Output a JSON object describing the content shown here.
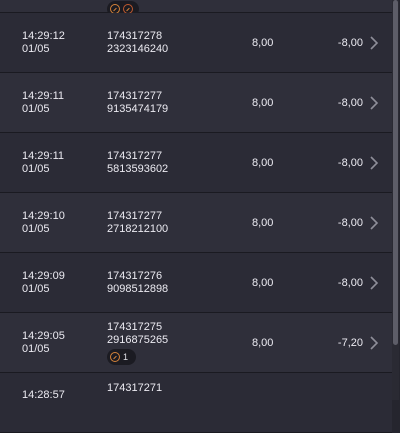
{
  "rows": [
    {
      "time": "",
      "date": "",
      "ticket_a": "",
      "ticket_b": "",
      "amount": "",
      "net": "",
      "badge": ""
    },
    {
      "time": "14:29:12",
      "date": "01/05",
      "ticket_a": "174317278",
      "ticket_b": "2323146240",
      "amount": "8,00",
      "net": "-8,00",
      "badge": ""
    },
    {
      "time": "14:29:11",
      "date": "01/05",
      "ticket_a": "174317277",
      "ticket_b": "9135474179",
      "amount": "8,00",
      "net": "-8,00",
      "badge": ""
    },
    {
      "time": "14:29:11",
      "date": "01/05",
      "ticket_a": "174317277",
      "ticket_b": "5813593602",
      "amount": "8,00",
      "net": "-8,00",
      "badge": ""
    },
    {
      "time": "14:29:10",
      "date": "01/05",
      "ticket_a": "174317277",
      "ticket_b": "2718212100",
      "amount": "8,00",
      "net": "-8,00",
      "badge": ""
    },
    {
      "time": "14:29:09",
      "date": "01/05",
      "ticket_a": "174317276",
      "ticket_b": "9098512898",
      "amount": "8,00",
      "net": "-8,00",
      "badge": ""
    },
    {
      "time": "14:29:05",
      "date": "01/05",
      "ticket_a": "174317275",
      "ticket_b": "2916875265",
      "amount": "8,00",
      "net": "-7,20",
      "badge": "1"
    },
    {
      "time": "14:28:57",
      "date": "",
      "ticket_a": "174317271",
      "ticket_b": "",
      "amount": "",
      "net": "",
      "badge": ""
    }
  ],
  "colors": {
    "accent": "#d4823a"
  },
  "icons": {
    "row_action": "chevron-right-icon",
    "badge": "boost-coin-icon"
  },
  "scroll": {
    "position_fraction": 0.85
  }
}
